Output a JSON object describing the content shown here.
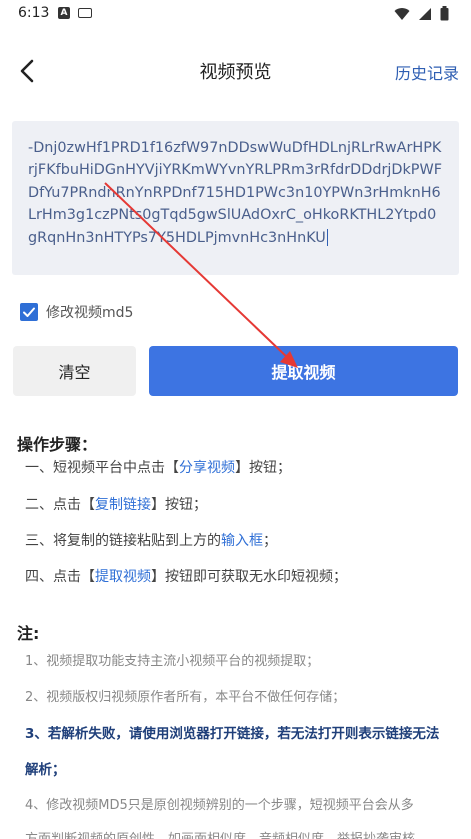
{
  "status_bar": {
    "time": "6:13"
  },
  "header": {
    "title": "视频预览",
    "history": "历史记录"
  },
  "input": {
    "url_text": "-Dnj0zwHf1PRD1f16zfW97nDDswWuDfHDLnjRLrRwArHPKrjFKfbuHiDGnHYVjiYRKmWYvnYRLPRm3rRfdrDDdrjDkPWFDfYu7PRndnRnYnRPDnf715HD1PWc3n10YPWn3rHmknH6LrHm3g1czPNts0gTqd5gwSlUAdOxrC_oHkoRKTHL2Ytpd0gRqnHn3nHTYPs7Y5HDLPjmvnHc3nHnKU"
  },
  "checkbox": {
    "label": "修改视频md5",
    "checked": true
  },
  "buttons": {
    "clear": "清空",
    "extract": "提取视频"
  },
  "steps": {
    "title": "操作步骤：",
    "s1_pre": "一、短视频平台中点击【",
    "s1_hl": "分享视频",
    "s1_post": "】按钮；",
    "s2_pre": "二、点击【",
    "s2_hl": "复制链接",
    "s2_post": "】按钮；",
    "s3_pre": "三、将复制的链接粘贴到上方的",
    "s3_hl": "输入框",
    "s3_post": "；",
    "s4_pre": "四、点击【",
    "s4_hl": "提取视频",
    "s4_post": "】按钮即可获取无水印短视频；"
  },
  "notes": {
    "title": "注:",
    "n1": "1、视频提取功能支持主流小视频平台的视频提取；",
    "n2": "2、视频版权归视频原作者所有，本平台不做任何存储；",
    "n3_line1": "3、若解析失败，请使用浏览器打开链接，若无法打开则表示链接无法",
    "n3_line2": "解析；",
    "n4_line1": "4、修改视频MD5只是原创视频辨别的一个步骤，短视频平台会从多",
    "n4_line2": "方面判断视频的原创性，如画面相似度、音频相似度、举报抄袭审核"
  },
  "colors": {
    "accent": "#3d74e2",
    "link": "#2f6fd6",
    "arrow": "#e53935"
  }
}
